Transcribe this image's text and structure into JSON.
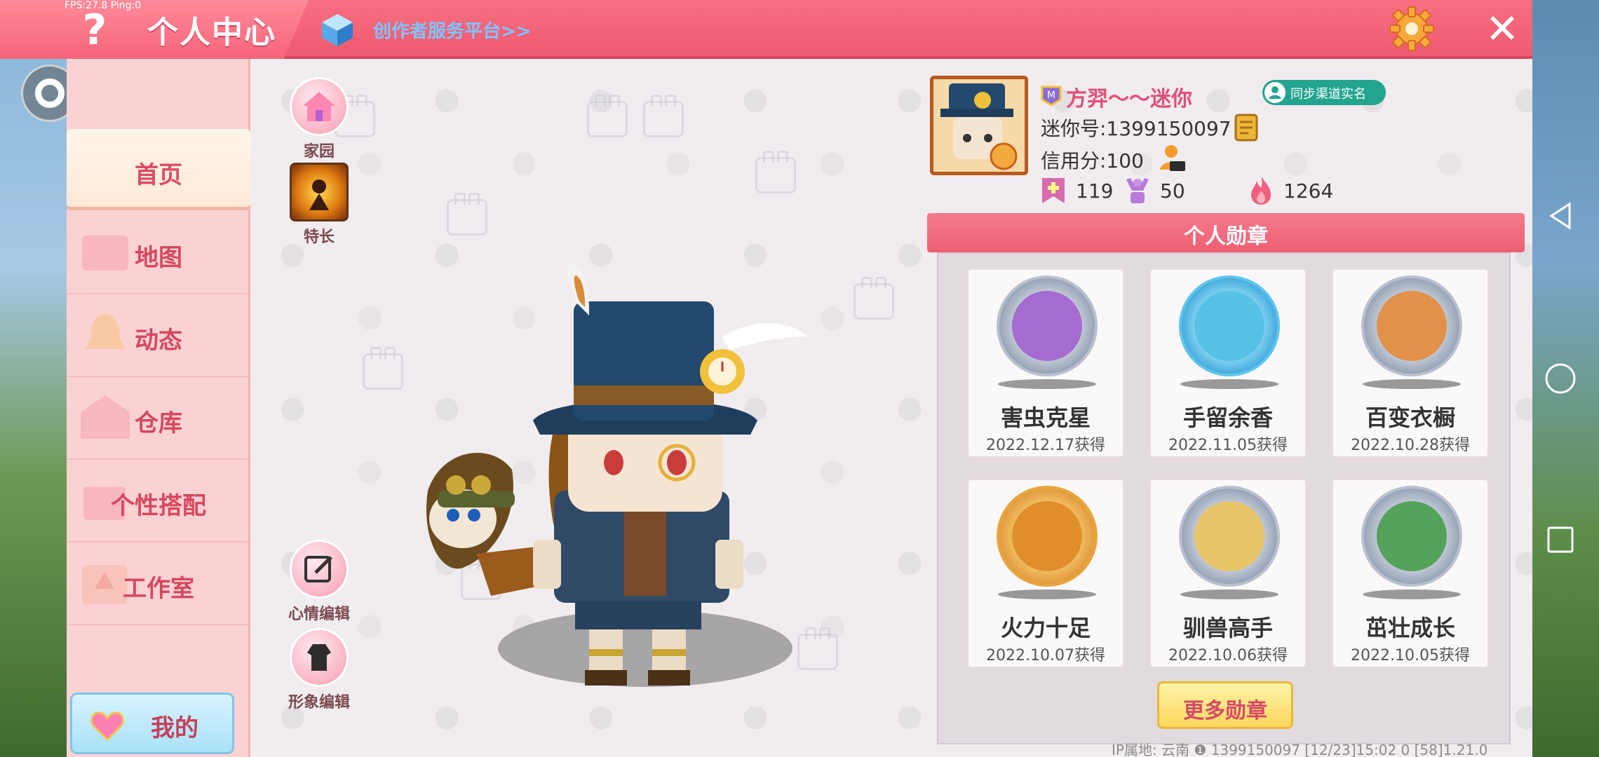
{
  "status": {
    "fps": "FPS:27.8  Ping:0"
  },
  "header": {
    "help_symbol": "?",
    "title": "个人中心",
    "creator_link": "创作者服务平台>>",
    "close_symbol": "✕"
  },
  "sidebar": {
    "items": [
      {
        "label": "首页",
        "icon": "home-icon",
        "active": true
      },
      {
        "label": "地图",
        "icon": "map-icon"
      },
      {
        "label": "动态",
        "icon": "bell-icon"
      },
      {
        "label": "仓库",
        "icon": "warehouse-icon"
      },
      {
        "label": "个性搭配",
        "icon": "outfit-icon"
      },
      {
        "label": "工作室",
        "icon": "studio-icon"
      }
    ],
    "mine_label": "我的"
  },
  "tools": {
    "home": "家园",
    "talent": "特长",
    "mood": "心情编辑",
    "appearance": "形象编辑"
  },
  "profile": {
    "name": "方羿～～迷你",
    "sync_label": "同步渠道实名",
    "mini_id": "迷你号:1399150097",
    "credit": "信用分:100",
    "stats": {
      "favorites": "119",
      "fans": "50",
      "popularity": "1264"
    }
  },
  "medals": {
    "header": "个人勋章",
    "items": [
      {
        "name": "害虫克星",
        "date": "2022.12.17获得",
        "color": "#a46bd1"
      },
      {
        "name": "手留余香",
        "date": "2022.11.05获得",
        "color": "#57c1e6"
      },
      {
        "name": "百变衣橱",
        "date": "2022.10.28获得",
        "color": "#e2914a"
      },
      {
        "name": "火力十足",
        "date": "2022.10.07获得",
        "color": "#e08d2c"
      },
      {
        "name": "驯兽高手",
        "date": "2022.10.06获得",
        "color": "#e8c56a"
      },
      {
        "name": "茁壮成长",
        "date": "2022.10.05获得",
        "color": "#55a35a"
      }
    ],
    "more_label": "更多勋章"
  },
  "footer": {
    "info": "IP属地: 云南 ❶     1399150097    [12/23]15:02 0   [58]1.21.0"
  },
  "colors": {
    "accent": "#ef5a70",
    "sidebar_bg": "#fbd2d4",
    "link": "#7fc4ff"
  }
}
